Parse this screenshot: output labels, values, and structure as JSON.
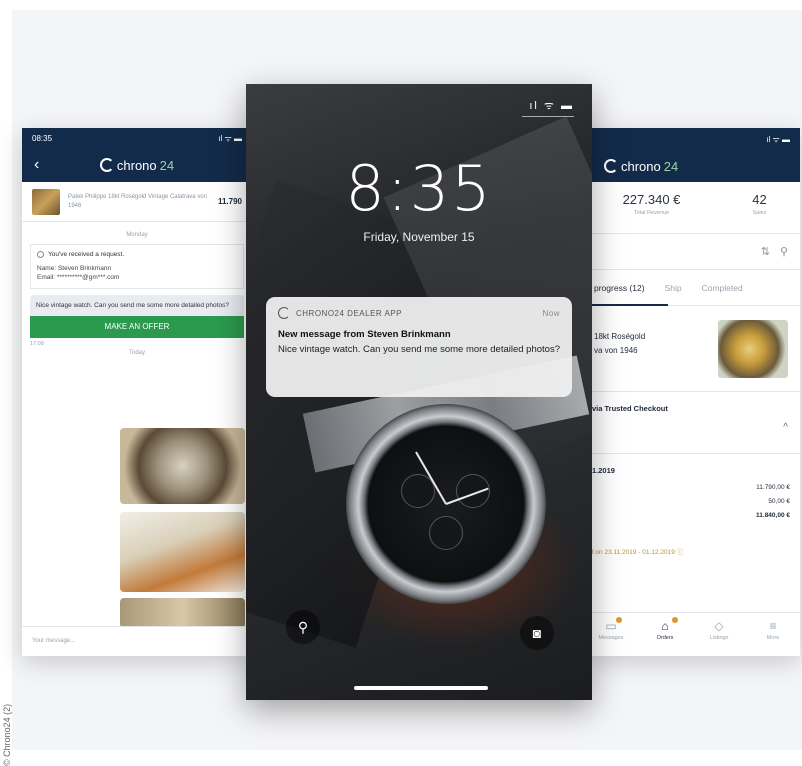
{
  "credit": "© Chrono24 (2)",
  "left": {
    "status_time": "08:35",
    "status_icons": "ıl ᯤ ▬",
    "brand_a": "chrono",
    "brand_b": "24",
    "item_title": "Patek Philippe 18kt Roségold Vintage Calatrava von 1946",
    "item_price": "11.790",
    "day_label": "Monday",
    "request_text": "You've received a request.",
    "name_line": "Name: Steven Brinkmann",
    "email_line": "Email: **********@gm***.com",
    "message": "Nice vintage watch. Can you send me some more detailed photos?",
    "offer_button": "MAKE AN OFFER",
    "msg_time": "17:08",
    "today_label": "Today",
    "input_placeholder": "Your message..."
  },
  "center": {
    "status": "ıl ᯤ ▬",
    "clock": "8:35",
    "date": "Friday, November 15",
    "notif_app": "CHRONO24 DEALER APP",
    "notif_time": "Now",
    "notif_title": "New message from Steven Brinkmann",
    "notif_body": "Nice vintage watch. Can you send me some more detailed photos?",
    "torch_icon": "flashlight-icon",
    "camera_icon": "camera-icon"
  },
  "right": {
    "status_icons": "ıl ᯤ ▬",
    "brand_a": "chrono",
    "brand_b": "24",
    "stat1_value": "227.340 €",
    "stat1_label": "Total Revenue",
    "stat2_value": "42",
    "stat2_label": "Sales",
    "tab1": "progress (12)",
    "tab2": "Ship",
    "tab3": "Completed",
    "order_line1": "18kt Roségold",
    "order_line2": "va von 1946",
    "trust": "via Trusted Checkout",
    "order_date": "1.2019",
    "amt1": "11.790,00 €",
    "amt2": "50,00 €",
    "amt3": "11.840,00 €",
    "pay_line": "d on 23.11.2019 - 01.12.2019 ⓘ",
    "nav": [
      "Messages",
      "Orders",
      "Listings",
      "More"
    ]
  }
}
